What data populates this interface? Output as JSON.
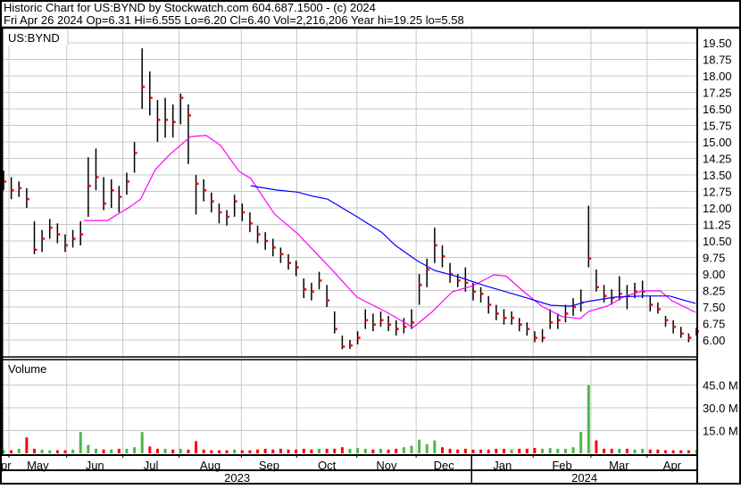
{
  "header": {
    "line1": "Historic Chart for US:BYND by Stockwatch.com 604.687.1500 - (c) 2024",
    "line2": "Fri Apr 26 2024  Op=6.31  Hi=6.555  Lo=6.20  Cl=6.40  Vol=2,216,206  Year hi=19.25  lo=5.58"
  },
  "colors": {
    "bar": "#000000",
    "close_tick": "#ff0000",
    "ma_short": "#ff00ff",
    "ma_long": "#0000ff",
    "vol_up": "#4cb84c",
    "vol_down": "#ff0000",
    "grid": "#c8c8c8"
  },
  "chart_data": {
    "type": "ohlc",
    "symbol_label": "US:BYND",
    "volume_label": "Volume",
    "ylim": [
      5.5,
      19.9
    ],
    "yticks": [
      "19.50",
      "18.75",
      "18.00",
      "17.25",
      "16.50",
      "15.75",
      "15.00",
      "14.25",
      "13.50",
      "12.75",
      "12.00",
      "11.25",
      "10.50",
      "9.75",
      "9.00",
      "8.25",
      "7.50",
      "6.75",
      "6.00"
    ],
    "vol_ylim_millions": [
      0,
      50
    ],
    "vol_ticks": [
      "45.0 M",
      "30.0 M",
      "15.0 M"
    ],
    "months": [
      {
        "label": "pr",
        "start": -0.5,
        "end": 0.7
      },
      {
        "label": "May",
        "start": 0.7,
        "end": 8.2
      },
      {
        "label": "Jun",
        "start": 8.2,
        "end": 15.5
      },
      {
        "label": "Jul",
        "start": 15.5,
        "end": 22.8
      },
      {
        "label": "Aug",
        "start": 22.8,
        "end": 30.9
      },
      {
        "label": "Sep",
        "start": 30.9,
        "end": 38.1
      },
      {
        "label": "Oct",
        "start": 38.1,
        "end": 45.9
      },
      {
        "label": "Nov",
        "start": 45.9,
        "end": 53.6
      },
      {
        "label": "Dec",
        "start": 53.6,
        "end": 60.8
      },
      {
        "label": "Jan",
        "start": 60.8,
        "end": 68.8
      },
      {
        "label": "Feb",
        "start": 68.8,
        "end": 76.3
      },
      {
        "label": "Mar",
        "start": 76.3,
        "end": 83.6
      },
      {
        "label": "Apr",
        "start": 83.6,
        "end": 90.5
      }
    ],
    "years": [
      {
        "label": "2023",
        "start": -0.5,
        "end": 60.8
      },
      {
        "label": "2024",
        "start": 60.8,
        "end": 90.5
      }
    ],
    "bars_hlc": [
      [
        13.7,
        12.8,
        13.2
      ],
      [
        13.4,
        12.4,
        12.8
      ],
      [
        13.2,
        12.5,
        12.9
      ],
      [
        12.9,
        12.0,
        12.4
      ],
      [
        11.4,
        9.9,
        10.1
      ],
      [
        11.0,
        10.0,
        10.6
      ],
      [
        11.5,
        10.6,
        11.1
      ],
      [
        11.3,
        10.4,
        10.8
      ],
      [
        10.8,
        10.0,
        10.3
      ],
      [
        11.0,
        10.2,
        10.6
      ],
      [
        11.4,
        10.3,
        10.8
      ],
      [
        14.3,
        11.6,
        13.0
      ],
      [
        14.7,
        12.8,
        13.4
      ],
      [
        13.4,
        11.9,
        12.2
      ],
      [
        13.3,
        12.0,
        12.8
      ],
      [
        13.0,
        11.8,
        12.5
      ],
      [
        13.6,
        12.6,
        13.2
      ],
      [
        15.0,
        13.6,
        14.5
      ],
      [
        19.25,
        16.5,
        17.5
      ],
      [
        18.2,
        16.2,
        17.0
      ],
      [
        16.9,
        15.0,
        16.0
      ],
      [
        17.0,
        15.2,
        16.0
      ],
      [
        16.7,
        15.2,
        15.9
      ],
      [
        17.2,
        15.8,
        17.0
      ],
      [
        16.7,
        14.0,
        16.2
      ],
      [
        13.5,
        11.7,
        13.1
      ],
      [
        13.3,
        12.3,
        12.8
      ],
      [
        12.7,
        11.8,
        12.3
      ],
      [
        12.2,
        11.3,
        11.8
      ],
      [
        11.9,
        11.2,
        11.6
      ],
      [
        12.6,
        11.6,
        12.3
      ],
      [
        12.2,
        11.4,
        11.8
      ],
      [
        11.8,
        10.9,
        11.3
      ],
      [
        11.2,
        10.4,
        10.8
      ],
      [
        10.9,
        10.1,
        10.5
      ],
      [
        10.6,
        9.8,
        10.2
      ],
      [
        10.2,
        9.5,
        9.9
      ],
      [
        9.9,
        9.2,
        9.5
      ],
      [
        9.6,
        8.9,
        9.3
      ],
      [
        8.8,
        7.9,
        8.3
      ],
      [
        8.6,
        7.8,
        8.2
      ],
      [
        9.1,
        8.3,
        8.7
      ],
      [
        8.5,
        7.5,
        7.8
      ],
      [
        7.3,
        6.3,
        6.5
      ],
      [
        6.2,
        5.58,
        5.7
      ],
      [
        6.0,
        5.6,
        5.75
      ],
      [
        6.4,
        5.8,
        6.1
      ],
      [
        7.4,
        6.5,
        6.9
      ],
      [
        7.2,
        6.4,
        6.7
      ],
      [
        7.3,
        6.6,
        6.9
      ],
      [
        7.1,
        6.4,
        6.7
      ],
      [
        6.9,
        6.2,
        6.5
      ],
      [
        7.0,
        6.3,
        6.6
      ],
      [
        7.4,
        6.5,
        6.8
      ],
      [
        9.0,
        7.6,
        8.5
      ],
      [
        9.7,
        8.4,
        9.2
      ],
      [
        11.1,
        9.5,
        10.3
      ],
      [
        10.3,
        9.3,
        9.8
      ],
      [
        9.5,
        8.6,
        9.0
      ],
      [
        9.0,
        8.4,
        8.7
      ],
      [
        9.3,
        8.2,
        8.6
      ],
      [
        8.6,
        7.8,
        8.2
      ],
      [
        8.4,
        7.7,
        8.1
      ],
      [
        8.0,
        7.2,
        7.6
      ],
      [
        7.6,
        6.9,
        7.2
      ],
      [
        7.4,
        6.7,
        7.0
      ],
      [
        7.3,
        6.7,
        7.0
      ],
      [
        7.0,
        6.4,
        6.7
      ],
      [
        6.8,
        6.2,
        6.5
      ],
      [
        6.4,
        5.9,
        6.1
      ],
      [
        6.5,
        5.9,
        6.1
      ],
      [
        7.4,
        6.5,
        6.8
      ],
      [
        7.2,
        6.5,
        6.9
      ],
      [
        7.6,
        6.8,
        7.2
      ],
      [
        7.9,
        7.1,
        7.5
      ],
      [
        8.3,
        7.3,
        7.7
      ],
      [
        12.1,
        9.3,
        9.7
      ],
      [
        9.2,
        8.2,
        8.4
      ],
      [
        8.5,
        7.7,
        8.0
      ],
      [
        8.3,
        7.6,
        7.9
      ],
      [
        8.9,
        7.8,
        8.1
      ],
      [
        8.5,
        7.4,
        8.0
      ],
      [
        8.6,
        7.9,
        8.2
      ],
      [
        8.7,
        7.9,
        8.2
      ],
      [
        8.0,
        7.3,
        7.6
      ],
      [
        7.7,
        7.2,
        7.4
      ],
      [
        7.1,
        6.6,
        6.9
      ],
      [
        6.9,
        6.3,
        6.6
      ],
      [
        6.6,
        6.1,
        6.3
      ],
      [
        6.3,
        5.9,
        6.1
      ],
      [
        6.555,
        6.2,
        6.4
      ]
    ],
    "volume_millions": [
      2,
      2,
      3,
      10.5,
      3,
      2.5,
      2,
      2,
      2,
      2.5,
      14,
      5.5,
      3,
      2.5,
      2.5,
      3,
      3,
      4,
      14,
      4.5,
      3,
      3,
      2.5,
      3,
      2.5,
      8,
      2.5,
      2,
      2,
      2,
      2.5,
      2,
      2,
      2.5,
      3,
      2.5,
      3,
      2.5,
      2.5,
      3,
      2.5,
      3,
      3,
      3,
      4,
      3,
      3.5,
      3,
      2.5,
      3,
      2.5,
      3,
      4,
      5,
      9,
      6,
      8.5,
      4,
      3,
      2.5,
      3,
      2.5,
      2.5,
      2.5,
      3,
      3,
      2.5,
      3,
      3,
      3.5,
      3,
      3.5,
      3,
      3,
      4,
      14,
      45,
      8.5,
      3,
      3,
      3,
      3,
      2.5,
      3,
      2.5,
      2.5,
      2,
      2,
      2,
      2,
      2.2
    ],
    "ma_short": [
      [
        10.4,
        11.43
      ],
      [
        13.5,
        11.43
      ],
      [
        16.2,
        12.0
      ],
      [
        17.8,
        12.4
      ],
      [
        19.7,
        13.74
      ],
      [
        21.6,
        14.43
      ],
      [
        24.3,
        15.24
      ],
      [
        26.3,
        15.3
      ],
      [
        28.2,
        14.84
      ],
      [
        30.6,
        13.66
      ],
      [
        32.1,
        13.34
      ],
      [
        35.2,
        11.72
      ],
      [
        38.2,
        10.83
      ],
      [
        42.1,
        9.4
      ],
      [
        45.9,
        7.95
      ],
      [
        49.8,
        7.26
      ],
      [
        53.2,
        6.57
      ],
      [
        55.6,
        7.26
      ],
      [
        58.3,
        8.19
      ],
      [
        61.0,
        8.47
      ],
      [
        63.7,
        8.96
      ],
      [
        65.3,
        8.9
      ],
      [
        67.6,
        8.19
      ],
      [
        69.9,
        7.54
      ],
      [
        72.6,
        7.06
      ],
      [
        74.9,
        6.97
      ],
      [
        76.0,
        7.3
      ],
      [
        78.4,
        7.54
      ],
      [
        80.7,
        7.99
      ],
      [
        83.0,
        8.23
      ],
      [
        85.3,
        8.23
      ],
      [
        86.8,
        7.79
      ],
      [
        89.9,
        7.26
      ]
    ],
    "ma_long": [
      [
        32.1,
        13.01
      ],
      [
        35.5,
        12.81
      ],
      [
        38.2,
        12.72
      ],
      [
        40.2,
        12.53
      ],
      [
        42.1,
        12.4
      ],
      [
        45.9,
        11.6
      ],
      [
        49.1,
        10.9
      ],
      [
        50.9,
        10.3
      ],
      [
        53.7,
        9.61
      ],
      [
        56.0,
        9.16
      ],
      [
        59.0,
        8.88
      ],
      [
        62.5,
        8.47
      ],
      [
        67.6,
        7.95
      ],
      [
        71.1,
        7.58
      ],
      [
        73.7,
        7.54
      ],
      [
        75.7,
        7.74
      ],
      [
        79.5,
        7.95
      ],
      [
        83.3,
        8.0
      ],
      [
        86.5,
        8.0
      ],
      [
        89.9,
        7.66
      ]
    ]
  }
}
